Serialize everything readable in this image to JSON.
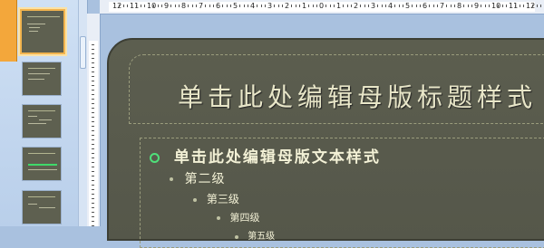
{
  "thumbnails": [
    {
      "number": "1",
      "selected": true
    },
    {
      "number": "2",
      "selected": false
    },
    {
      "number": "3",
      "selected": false
    },
    {
      "number": "4",
      "selected": false
    },
    {
      "number": "5",
      "selected": false
    }
  ],
  "ruler": {
    "horizontal_labels": [
      "12",
      "11",
      "10",
      "9",
      "8",
      "7",
      "6",
      "5",
      "4",
      "3",
      "2",
      "1",
      "0",
      "1",
      "2",
      "3",
      "4",
      "5",
      "6",
      "7",
      "8",
      "9",
      "10",
      "11",
      "12"
    ]
  },
  "slide": {
    "title": "单击此处编辑母版标题样式",
    "levels": {
      "l1": "单击此处编辑母版文本样式",
      "l2": "第二级",
      "l3": "第三级",
      "l4": "第四级",
      "l5": "第五级"
    }
  },
  "colors": {
    "slide_bg": "#5c5e4f",
    "accent_bullet": "#4fe07a",
    "selected_thumb": "#f3a73b"
  }
}
